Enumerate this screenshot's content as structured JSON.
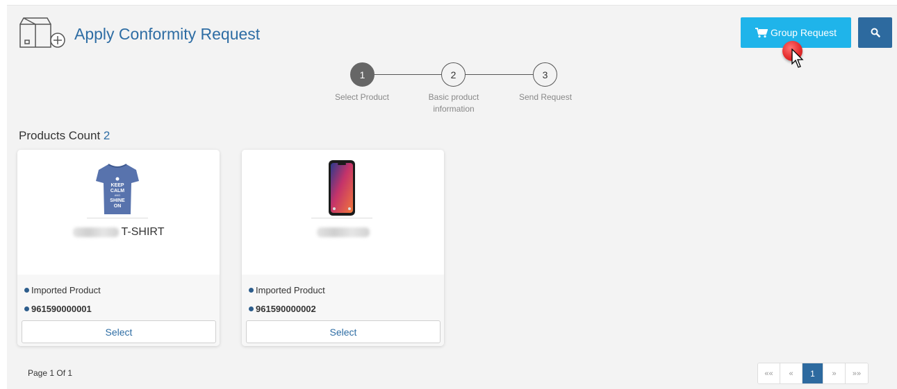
{
  "header": {
    "title": "Apply Conformity Request",
    "group_request_label": "Group Request",
    "icons": {
      "cart": "cart-icon",
      "search": "search-icon",
      "header": "box-plus-icon"
    }
  },
  "stepper": {
    "steps": [
      {
        "number": "1",
        "label": "Select Product",
        "active": true
      },
      {
        "number": "2",
        "label": "Basic product information",
        "active": false
      },
      {
        "number": "3",
        "label": "Send Request",
        "active": false
      }
    ]
  },
  "products": {
    "count_label": "Products Count",
    "count": "2",
    "items": [
      {
        "name_suffix": "T-SHIRT",
        "type": "Imported Product",
        "code": "961590000001",
        "select_label": "Select",
        "image": "tshirt-image",
        "shirt_text": "KEEP CALM AND SHINE ON"
      },
      {
        "name_suffix": "",
        "type": "Imported Product",
        "code": "961590000002",
        "select_label": "Select",
        "image": "phone-image"
      }
    ]
  },
  "footer": {
    "page_info": "Page 1 Of 1",
    "pagination": {
      "first": "««",
      "prev": "«",
      "current": "1",
      "next": "»",
      "last": "»»"
    }
  },
  "colors": {
    "accent": "#1fb4ea",
    "primary": "#2d6a9f",
    "title": "#2e6da4",
    "step_active": "#666666"
  }
}
